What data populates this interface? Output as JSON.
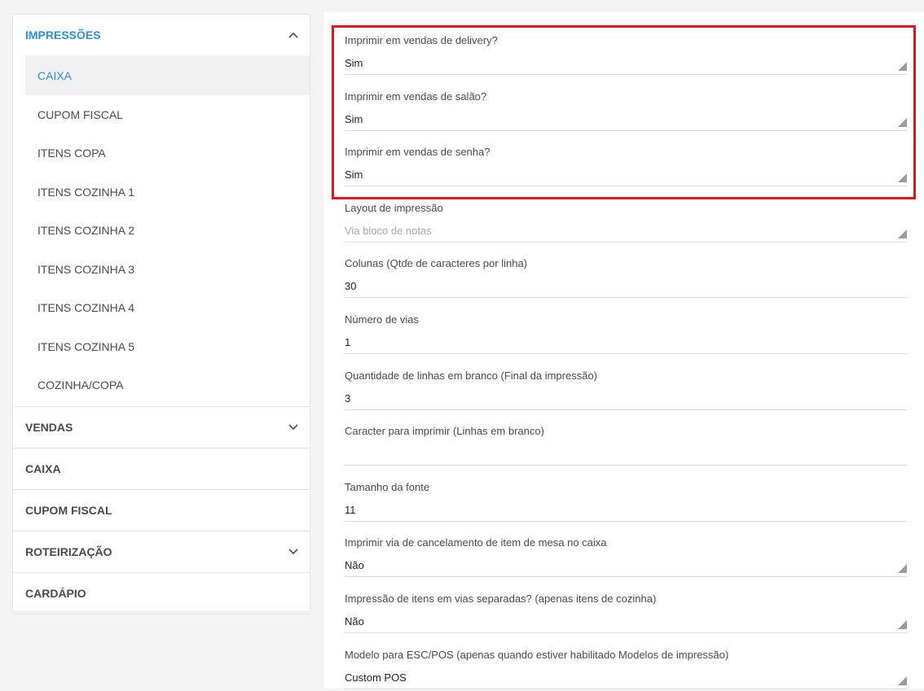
{
  "sidebar": {
    "groups": [
      {
        "label": "IMPRESSÕES",
        "open": true,
        "items": [
          "CAIXA",
          "CUPOM FISCAL",
          "ITENS COPA",
          "ITENS COZINHA 1",
          "ITENS COZINHA 2",
          "ITENS COZINHA 3",
          "ITENS COZINHA 4",
          "ITENS COZINHA 5",
          "COZINHA/COPA"
        ],
        "active_item": "CAIXA"
      },
      {
        "label": "VENDAS",
        "has_chevron": true
      },
      {
        "label": "CAIXA"
      },
      {
        "label": "CUPOM FISCAL"
      },
      {
        "label": "ROTEIRIZAÇÃO",
        "has_chevron": true
      },
      {
        "label": "CARDÁPIO"
      }
    ]
  },
  "form": {
    "fields": [
      {
        "label": "Imprimir em vendas de delivery?",
        "value": "Sim",
        "type": "select"
      },
      {
        "label": "Imprimir em vendas de salão?",
        "value": "Sim",
        "type": "select"
      },
      {
        "label": "Imprimir em vendas de senha?",
        "value": "Sim",
        "type": "select"
      },
      {
        "label": "Layout de impressão",
        "value": "Via bloco de notas",
        "type": "select",
        "placeholder": true
      },
      {
        "label": "Colunas (Qtde de caracteres por linha)",
        "value": "30",
        "type": "input"
      },
      {
        "label": "Número de vias",
        "value": "1",
        "type": "input"
      },
      {
        "label": "Quantidade de linhas em branco (Final da impressão)",
        "value": "3",
        "type": "input"
      },
      {
        "label": "Caracter para imprimir (Linhas em branco)",
        "value": "",
        "type": "input"
      },
      {
        "label": "Tamanho da fonte",
        "value": "11",
        "type": "input"
      },
      {
        "label": "Imprimir via de cancelamento de item de mesa no caixa",
        "value": "Não",
        "type": "select"
      },
      {
        "label": "Impressão de itens em vias separadas? (apenas itens de cozinha)",
        "value": "Não",
        "type": "select"
      },
      {
        "label": "Modelo para ESC/POS (apenas quando estiver habilitado Modelos de impressão)",
        "value": "Custom POS",
        "type": "select"
      }
    ]
  },
  "colors": {
    "accent": "#2e8ddc",
    "highlight": "#e8141c"
  },
  "icons": {
    "chevron_up": "chevron-up-icon",
    "chevron_down": "chevron-down-icon",
    "select_arrow": "select-arrow-icon"
  }
}
